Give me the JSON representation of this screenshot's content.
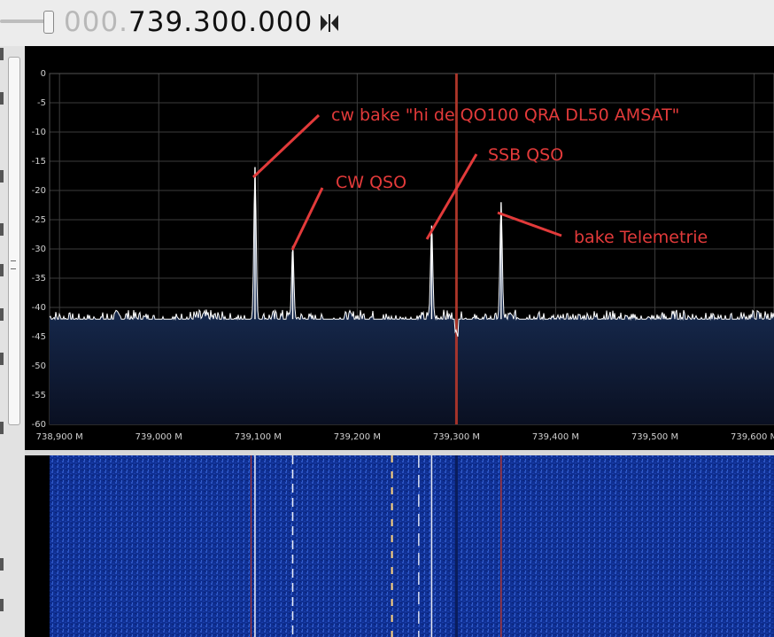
{
  "frequency": {
    "leading_zeros": "000.",
    "value": "739.300.000"
  },
  "spectrum": {
    "y_ticks": [
      "0",
      "-5",
      "-10",
      "-15",
      "-20",
      "-25",
      "-30",
      "-35",
      "-40",
      "-45",
      "-50",
      "-55",
      "-60"
    ],
    "x_ticks": [
      "738,900 M",
      "739,000 M",
      "739,100 M",
      "739,200 M",
      "739,300 M",
      "739,400 M",
      "739,500 M",
      "739,600 M"
    ],
    "annotations": {
      "cw_bake": "cw bake \"hi de QO100 QRA DL50 AMSAT\"",
      "cw_qso": "CW QSO",
      "ssb_qso": "SSB QSO",
      "bake_telemetrie": "bake Telemetrie"
    },
    "colors": {
      "background": "#000000",
      "grid": "#3c3c3c",
      "trace": "#ffffff",
      "fill": "#1e3f7a",
      "marker": "#c0392b",
      "annotation": "#e23a3a"
    }
  },
  "chart_data": {
    "type": "line",
    "x_unit": "MHz",
    "y_unit": "dB",
    "xlim": [
      738.89,
      739.62
    ],
    "ylim": [
      -60,
      0
    ],
    "noise_floor": -42,
    "center_marker": 739.3,
    "peaks": [
      {
        "x": 739.097,
        "y": -16
      },
      {
        "x": 739.135,
        "y": -29.5
      },
      {
        "x": 739.275,
        "y": -26
      },
      {
        "x": 739.345,
        "y": -22
      }
    ]
  },
  "waterfall": {
    "colors": {
      "base": "#0f2f92",
      "signal": "#ffffff",
      "marker": "#c0392b"
    }
  }
}
